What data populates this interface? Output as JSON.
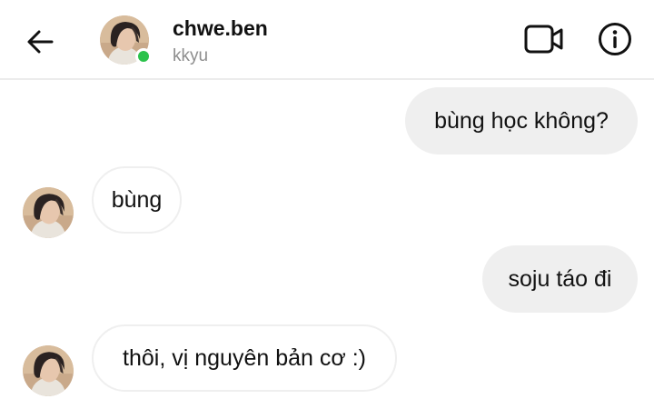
{
  "header": {
    "name": "chwe.ben",
    "username": "kkyu",
    "online": true,
    "icons": {
      "back": "arrow-left-icon",
      "video": "video-camera-icon",
      "info": "info-circle-icon"
    }
  },
  "messages": [
    {
      "side": "sent",
      "text": "bùng học không?"
    },
    {
      "side": "received",
      "text": "bùng"
    },
    {
      "side": "sent",
      "text": "soju táo đi"
    },
    {
      "side": "received",
      "text": "thôi, vị nguyên bản cơ :)"
    }
  ],
  "colors": {
    "sent_bubble": "#efefef",
    "received_border": "#efefef",
    "online_dot": "#2bc24b",
    "secondary_text": "#8e8e8e"
  }
}
